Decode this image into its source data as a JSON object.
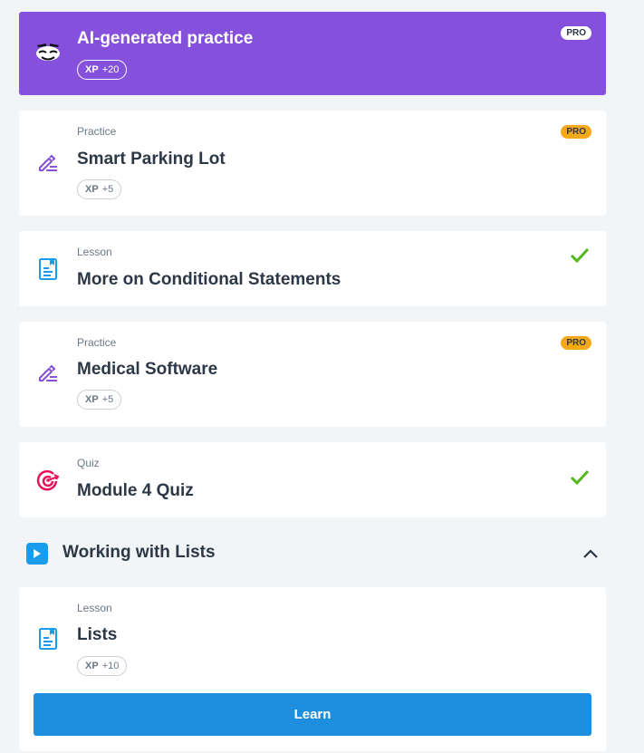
{
  "cards": [
    {
      "kind": "",
      "title": "AI-generated practice",
      "xp_label": "XP",
      "xp_value": "+20",
      "pro": "PRO"
    },
    {
      "kind": "Practice",
      "title": "Smart Parking Lot",
      "xp_label": "XP",
      "xp_value": "+5",
      "pro": "PRO"
    },
    {
      "kind": "Lesson",
      "title": "More on Conditional Statements",
      "completed": true
    },
    {
      "kind": "Practice",
      "title": "Medical Software",
      "xp_label": "XP",
      "xp_value": "+5",
      "pro": "PRO"
    },
    {
      "kind": "Quiz",
      "title": "Module 4 Quiz",
      "completed": true
    }
  ],
  "section": {
    "title": "Working with Lists",
    "expanded": true
  },
  "section_cards": [
    {
      "kind": "Lesson",
      "title": "Lists",
      "xp_label": "XP",
      "xp_value": "+10",
      "button": "Learn"
    }
  ],
  "colors": {
    "ai_card": "#8551dc",
    "pro_badge": "#f6a917",
    "check": "#52b81c",
    "learn_button": "#1e8ede",
    "section_icon": "#1a9cea"
  },
  "icons": [
    "ai-mascot-icon",
    "pencil-icon",
    "lesson-doc-icon",
    "pencil-icon",
    "target-icon",
    "play-icon",
    "chevron-up-icon",
    "lesson-doc-icon",
    "checkmark-icon"
  ]
}
